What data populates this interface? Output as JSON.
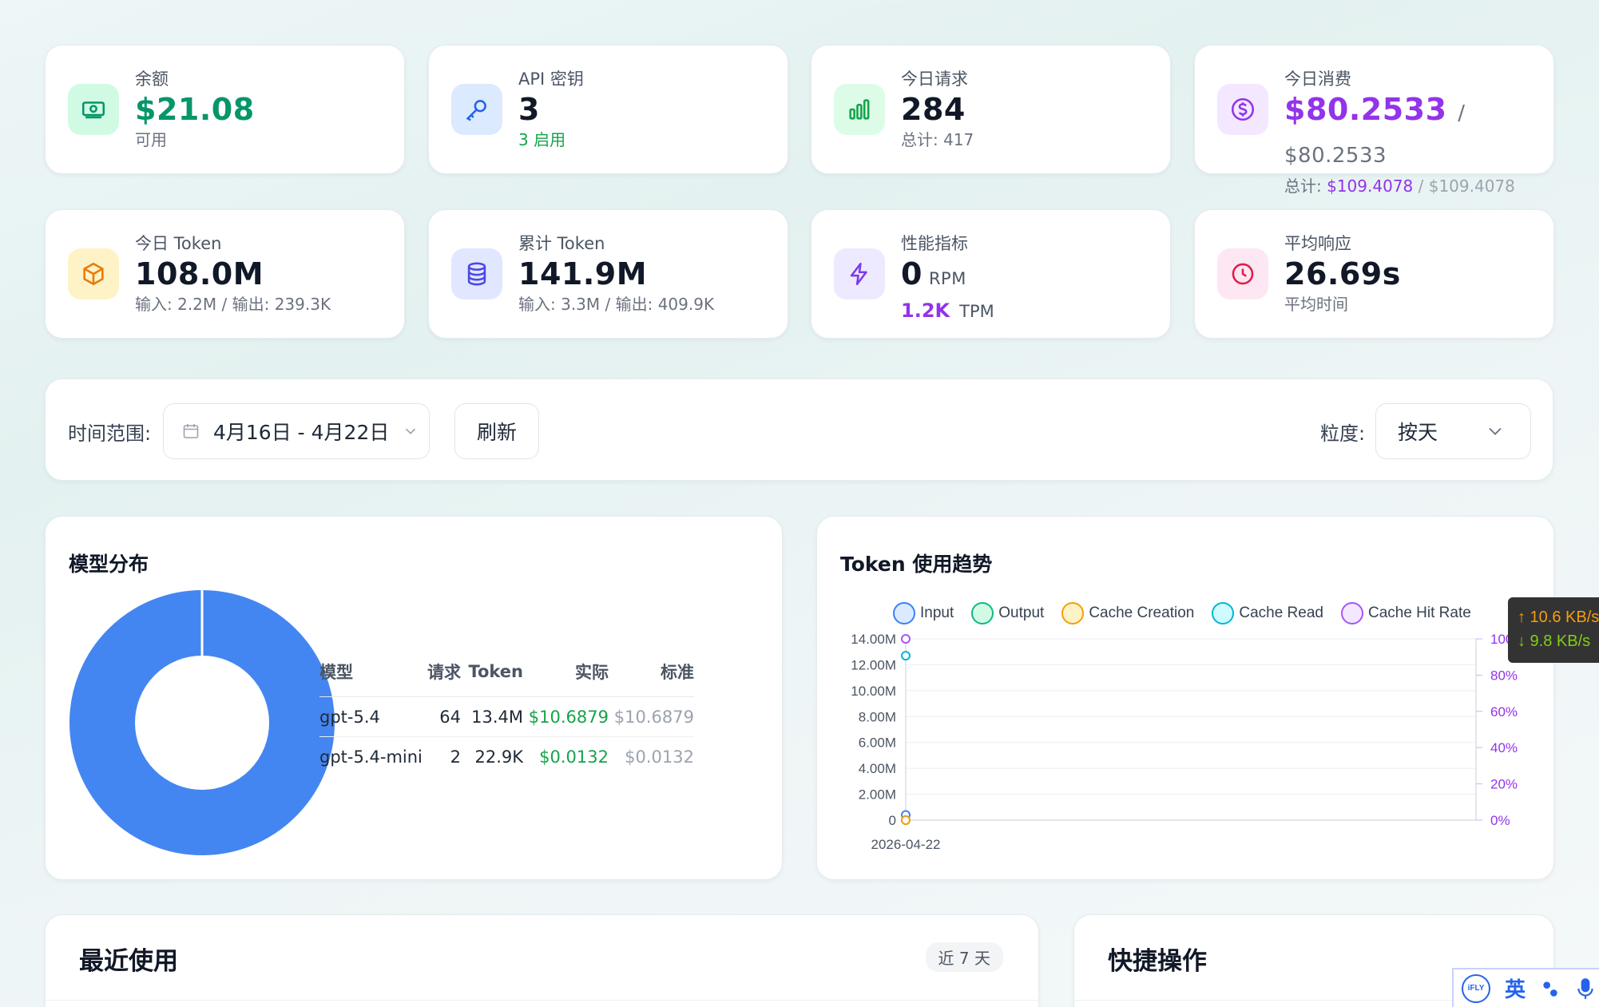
{
  "stats_row1": [
    {
      "label": "余额",
      "value": "$21.08",
      "sub": "可用",
      "icon": "money-icon",
      "color": "#059669"
    },
    {
      "label": "API 密钥",
      "value": "3",
      "sub": "3 启用",
      "icon": "key-icon",
      "color": "#2563eb"
    },
    {
      "label": "今日请求",
      "value": "284",
      "sub": "总计: 417",
      "icon": "bar-chart-icon",
      "color": "#16a34a"
    },
    {
      "label": "今日消费",
      "value": "$80.2533",
      "value_std": "/ $80.2533",
      "sub_prefix": "总计:",
      "sub_actual": "$109.4078",
      "sub_std": "/ $109.4078",
      "icon": "dollar-icon",
      "color": "#9333ea"
    }
  ],
  "stats_row2": [
    {
      "label": "今日 Token",
      "value": "108.0M",
      "sub": "输入: 2.2M / 输出: 239.3K",
      "icon": "cube-icon"
    },
    {
      "label": "累计 Token",
      "value": "141.9M",
      "sub": "输入: 3.3M / 输出: 409.9K",
      "icon": "database-icon"
    },
    {
      "label": "性能指标",
      "value": "0",
      "unit": "RPM",
      "sub_value": "1.2K",
      "sub_unit": "TPM",
      "icon": "bolt-icon"
    },
    {
      "label": "平均响应",
      "value": "26.69s",
      "sub": "平均时间",
      "icon": "clock-icon"
    }
  ],
  "filter": {
    "range_label": "时间范围:",
    "range_value": "4月16日 - 4月22日",
    "refresh_label": "刷新",
    "granularity_label": "粒度:",
    "granularity_value": "按天"
  },
  "model_panel": {
    "title": "模型分布",
    "headers": [
      "模型",
      "请求",
      "Token",
      "实际",
      "标准"
    ],
    "rows": [
      {
        "model": "gpt-5.4",
        "requests": "64",
        "tokens": "13.4M",
        "actual": "$10.6879",
        "standard": "$10.6879"
      },
      {
        "model": "gpt-5.4-mini",
        "requests": "2",
        "tokens": "22.9K",
        "actual": "$0.0132",
        "standard": "$0.0132"
      }
    ]
  },
  "chart_data": {
    "type": "line",
    "title": "Token 使用趋势",
    "x": [
      "2026-04-22"
    ],
    "series": [
      {
        "name": "Input",
        "values": [
          400000
        ],
        "color": "#3b82f6"
      },
      {
        "name": "Output",
        "values": [
          0
        ],
        "color": "#10b981"
      },
      {
        "name": "Cache Creation",
        "values": [
          0
        ],
        "color": "#f59e0b"
      },
      {
        "name": "Cache Read",
        "values": [
          12700000
        ],
        "color": "#06b6d4"
      },
      {
        "name": "Cache Hit Rate",
        "values": [
          100
        ],
        "axis": "right",
        "color": "#a855f7"
      }
    ],
    "y_left_ticks": [
      "0",
      "2.00M",
      "4.00M",
      "6.00M",
      "8.00M",
      "10.00M",
      "12.00M",
      "14.00M"
    ],
    "y_right_ticks": [
      "0%",
      "20%",
      "40%",
      "60%",
      "80%",
      "100%"
    ],
    "ylim_left": [
      0,
      14000000
    ],
    "ylim_right": [
      0,
      100
    ],
    "legend_position": "top",
    "grid": true
  },
  "network": {
    "up": "↑ 10.6 KB/s",
    "down": "↓ 9.8 KB/s"
  },
  "recent": {
    "title": "最近使用",
    "badge": "近 7 天"
  },
  "quick": {
    "title": "快捷操作"
  },
  "ime": {
    "logo": "iFLY",
    "lang": "英"
  }
}
